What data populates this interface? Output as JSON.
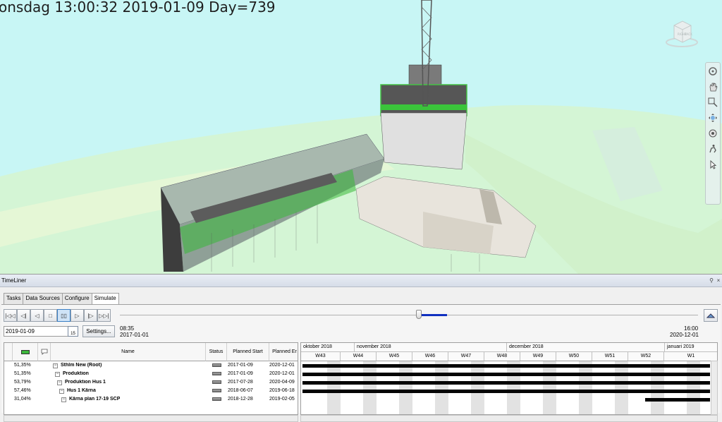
{
  "viewport": {
    "overlay_text": "onsdag 13:00:32 2019-01-09 Day=739",
    "viewcube_faces": [
      "RIGHT",
      "BACK"
    ],
    "nav_tools": [
      "steering-wheel-icon",
      "pan-hand-icon",
      "zoom-window-icon",
      "orbit-icon",
      "look-icon",
      "walk-icon",
      "select-cursor-icon"
    ]
  },
  "timeliner": {
    "title": "TimeLiner",
    "window_controls": [
      "pin-icon",
      "close-icon"
    ],
    "tabs": [
      "Tasks",
      "Data Sources",
      "Configure",
      "Simulate"
    ],
    "active_tab": "Simulate",
    "transport": [
      "rewind-start",
      "step-back",
      "play-reverse",
      "stop",
      "pause",
      "play",
      "step-forward",
      "forward-end"
    ],
    "current_date": "2019-01-09",
    "calendar_day": "15",
    "settings_label": "Settings...",
    "start_time": "08:35",
    "start_date": "2017-01-01",
    "end_time": "16:00",
    "end_date": "2020-12-01",
    "columns": {
      "name": "Name",
      "status": "Status",
      "planned_start": "Planned Start",
      "planned_end": "Planned Er"
    },
    "tasks": [
      {
        "progress": "51,35%",
        "name": "Sthlm New (Root)",
        "expander": "−",
        "planned_start": "2017-01-09",
        "planned_end": "2020-12-01"
      },
      {
        "progress": "51,35%",
        "name": "Produktion",
        "expander": "−",
        "planned_start": "2017-01-09",
        "planned_end": "2020-12-01"
      },
      {
        "progress": "53,79%",
        "name": "Produktion Hus 1",
        "expander": "−",
        "planned_start": "2017-07-28",
        "planned_end": "2020-04-09"
      },
      {
        "progress": "57,46%",
        "name": "Hus 1 Kärna",
        "expander": "−",
        "planned_start": "2018-06-07",
        "planned_end": "2019-06-18"
      },
      {
        "progress": "31,04%",
        "name": "Kärna plan 17-19 SCP",
        "expander": "−",
        "planned_start": "2018-12-28",
        "planned_end": "2019-02-05"
      }
    ],
    "gantt": {
      "months": [
        "oktober 2018",
        "november 2018",
        "december 2018",
        "januari 2019"
      ],
      "weeks": [
        "W43",
        "W44",
        "W45",
        "W46",
        "W47",
        "W48",
        "W49",
        "W50",
        "W51",
        "W52",
        "W1"
      ]
    }
  }
}
